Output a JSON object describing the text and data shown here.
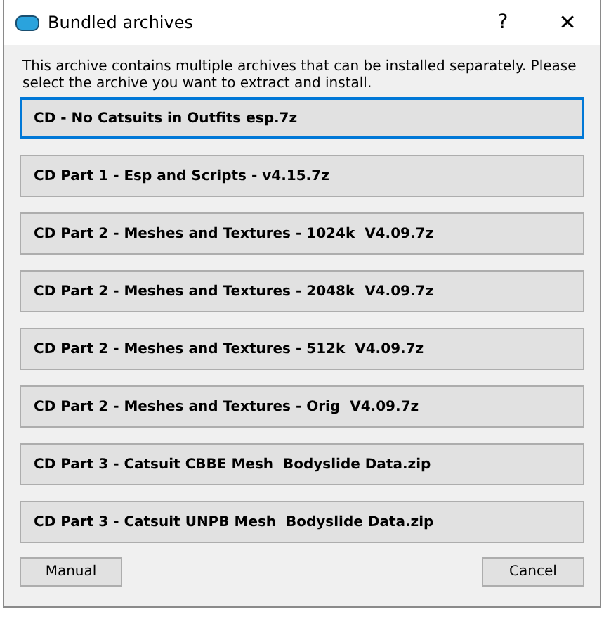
{
  "window": {
    "title": "Bundled archives",
    "help": "?",
    "close": "✕"
  },
  "message": "This archive contains multiple archives that can be installed separately. Please select the archive you want to extract and install.",
  "archives": [
    {
      "label": "CD - No Catsuits in Outfits esp.7z",
      "selected": true
    },
    {
      "label": "CD Part 1 - Esp and Scripts - v4.15.7z",
      "selected": false
    },
    {
      "label": "CD Part 2 - Meshes and Textures - 1024k  V4.09.7z",
      "selected": false
    },
    {
      "label": "CD Part 2 - Meshes and Textures - 2048k  V4.09.7z",
      "selected": false
    },
    {
      "label": "CD Part 2 - Meshes and Textures - 512k  V4.09.7z",
      "selected": false
    },
    {
      "label": "CD Part 2 - Meshes and Textures - Orig  V4.09.7z",
      "selected": false
    },
    {
      "label": "CD Part 3 - Catsuit CBBE Mesh  Bodyslide Data.zip",
      "selected": false
    },
    {
      "label": "CD Part 3 - Catsuit UNPB Mesh  Bodyslide Data.zip",
      "selected": false
    }
  ],
  "buttons": {
    "left": "Manual",
    "right": "Cancel"
  }
}
